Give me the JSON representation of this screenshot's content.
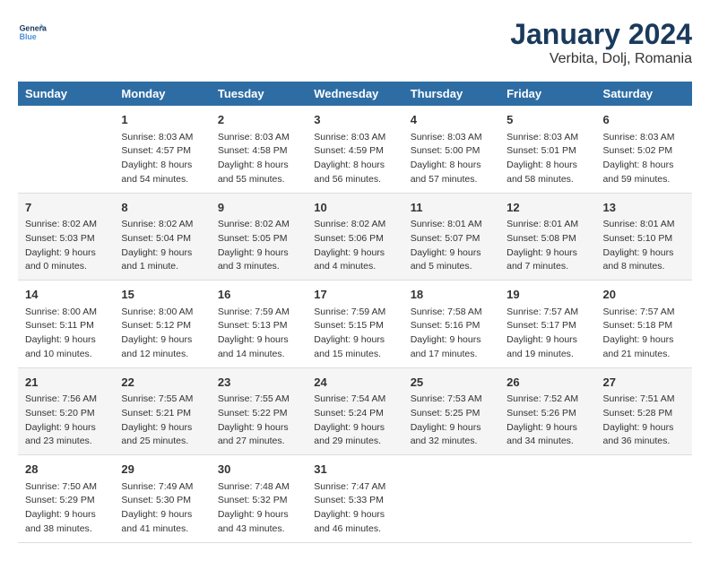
{
  "header": {
    "logo_line1": "General",
    "logo_line2": "Blue",
    "month_year": "January 2024",
    "location": "Verbita, Dolj, Romania"
  },
  "days_of_week": [
    "Sunday",
    "Monday",
    "Tuesday",
    "Wednesday",
    "Thursday",
    "Friday",
    "Saturday"
  ],
  "weeks": [
    [
      {
        "day": "",
        "sunrise": "",
        "sunset": "",
        "daylight": ""
      },
      {
        "day": "1",
        "sunrise": "Sunrise: 8:03 AM",
        "sunset": "Sunset: 4:57 PM",
        "daylight": "Daylight: 8 hours and 54 minutes."
      },
      {
        "day": "2",
        "sunrise": "Sunrise: 8:03 AM",
        "sunset": "Sunset: 4:58 PM",
        "daylight": "Daylight: 8 hours and 55 minutes."
      },
      {
        "day": "3",
        "sunrise": "Sunrise: 8:03 AM",
        "sunset": "Sunset: 4:59 PM",
        "daylight": "Daylight: 8 hours and 56 minutes."
      },
      {
        "day": "4",
        "sunrise": "Sunrise: 8:03 AM",
        "sunset": "Sunset: 5:00 PM",
        "daylight": "Daylight: 8 hours and 57 minutes."
      },
      {
        "day": "5",
        "sunrise": "Sunrise: 8:03 AM",
        "sunset": "Sunset: 5:01 PM",
        "daylight": "Daylight: 8 hours and 58 minutes."
      },
      {
        "day": "6",
        "sunrise": "Sunrise: 8:03 AM",
        "sunset": "Sunset: 5:02 PM",
        "daylight": "Daylight: 8 hours and 59 minutes."
      }
    ],
    [
      {
        "day": "7",
        "sunrise": "Sunrise: 8:02 AM",
        "sunset": "Sunset: 5:03 PM",
        "daylight": "Daylight: 9 hours and 0 minutes."
      },
      {
        "day": "8",
        "sunrise": "Sunrise: 8:02 AM",
        "sunset": "Sunset: 5:04 PM",
        "daylight": "Daylight: 9 hours and 1 minute."
      },
      {
        "day": "9",
        "sunrise": "Sunrise: 8:02 AM",
        "sunset": "Sunset: 5:05 PM",
        "daylight": "Daylight: 9 hours and 3 minutes."
      },
      {
        "day": "10",
        "sunrise": "Sunrise: 8:02 AM",
        "sunset": "Sunset: 5:06 PM",
        "daylight": "Daylight: 9 hours and 4 minutes."
      },
      {
        "day": "11",
        "sunrise": "Sunrise: 8:01 AM",
        "sunset": "Sunset: 5:07 PM",
        "daylight": "Daylight: 9 hours and 5 minutes."
      },
      {
        "day": "12",
        "sunrise": "Sunrise: 8:01 AM",
        "sunset": "Sunset: 5:08 PM",
        "daylight": "Daylight: 9 hours and 7 minutes."
      },
      {
        "day": "13",
        "sunrise": "Sunrise: 8:01 AM",
        "sunset": "Sunset: 5:10 PM",
        "daylight": "Daylight: 9 hours and 8 minutes."
      }
    ],
    [
      {
        "day": "14",
        "sunrise": "Sunrise: 8:00 AM",
        "sunset": "Sunset: 5:11 PM",
        "daylight": "Daylight: 9 hours and 10 minutes."
      },
      {
        "day": "15",
        "sunrise": "Sunrise: 8:00 AM",
        "sunset": "Sunset: 5:12 PM",
        "daylight": "Daylight: 9 hours and 12 minutes."
      },
      {
        "day": "16",
        "sunrise": "Sunrise: 7:59 AM",
        "sunset": "Sunset: 5:13 PM",
        "daylight": "Daylight: 9 hours and 14 minutes."
      },
      {
        "day": "17",
        "sunrise": "Sunrise: 7:59 AM",
        "sunset": "Sunset: 5:15 PM",
        "daylight": "Daylight: 9 hours and 15 minutes."
      },
      {
        "day": "18",
        "sunrise": "Sunrise: 7:58 AM",
        "sunset": "Sunset: 5:16 PM",
        "daylight": "Daylight: 9 hours and 17 minutes."
      },
      {
        "day": "19",
        "sunrise": "Sunrise: 7:57 AM",
        "sunset": "Sunset: 5:17 PM",
        "daylight": "Daylight: 9 hours and 19 minutes."
      },
      {
        "day": "20",
        "sunrise": "Sunrise: 7:57 AM",
        "sunset": "Sunset: 5:18 PM",
        "daylight": "Daylight: 9 hours and 21 minutes."
      }
    ],
    [
      {
        "day": "21",
        "sunrise": "Sunrise: 7:56 AM",
        "sunset": "Sunset: 5:20 PM",
        "daylight": "Daylight: 9 hours and 23 minutes."
      },
      {
        "day": "22",
        "sunrise": "Sunrise: 7:55 AM",
        "sunset": "Sunset: 5:21 PM",
        "daylight": "Daylight: 9 hours and 25 minutes."
      },
      {
        "day": "23",
        "sunrise": "Sunrise: 7:55 AM",
        "sunset": "Sunset: 5:22 PM",
        "daylight": "Daylight: 9 hours and 27 minutes."
      },
      {
        "day": "24",
        "sunrise": "Sunrise: 7:54 AM",
        "sunset": "Sunset: 5:24 PM",
        "daylight": "Daylight: 9 hours and 29 minutes."
      },
      {
        "day": "25",
        "sunrise": "Sunrise: 7:53 AM",
        "sunset": "Sunset: 5:25 PM",
        "daylight": "Daylight: 9 hours and 32 minutes."
      },
      {
        "day": "26",
        "sunrise": "Sunrise: 7:52 AM",
        "sunset": "Sunset: 5:26 PM",
        "daylight": "Daylight: 9 hours and 34 minutes."
      },
      {
        "day": "27",
        "sunrise": "Sunrise: 7:51 AM",
        "sunset": "Sunset: 5:28 PM",
        "daylight": "Daylight: 9 hours and 36 minutes."
      }
    ],
    [
      {
        "day": "28",
        "sunrise": "Sunrise: 7:50 AM",
        "sunset": "Sunset: 5:29 PM",
        "daylight": "Daylight: 9 hours and 38 minutes."
      },
      {
        "day": "29",
        "sunrise": "Sunrise: 7:49 AM",
        "sunset": "Sunset: 5:30 PM",
        "daylight": "Daylight: 9 hours and 41 minutes."
      },
      {
        "day": "30",
        "sunrise": "Sunrise: 7:48 AM",
        "sunset": "Sunset: 5:32 PM",
        "daylight": "Daylight: 9 hours and 43 minutes."
      },
      {
        "day": "31",
        "sunrise": "Sunrise: 7:47 AM",
        "sunset": "Sunset: 5:33 PM",
        "daylight": "Daylight: 9 hours and 46 minutes."
      },
      {
        "day": "",
        "sunrise": "",
        "sunset": "",
        "daylight": ""
      },
      {
        "day": "",
        "sunrise": "",
        "sunset": "",
        "daylight": ""
      },
      {
        "day": "",
        "sunrise": "",
        "sunset": "",
        "daylight": ""
      }
    ]
  ]
}
